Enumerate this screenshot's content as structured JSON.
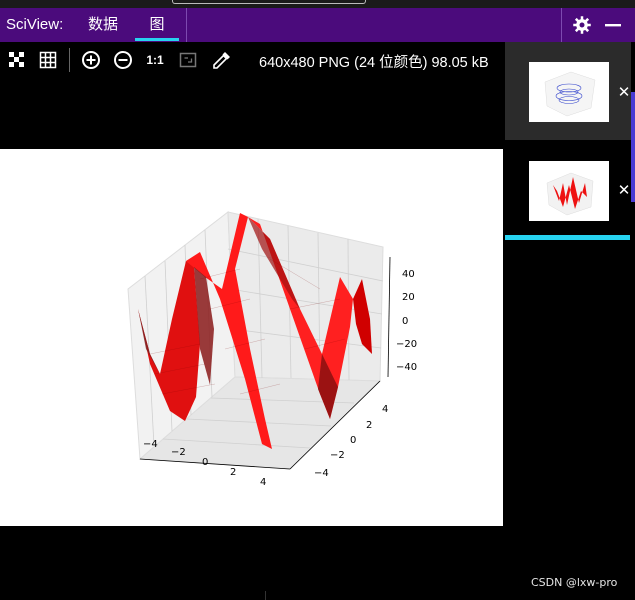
{
  "header": {
    "app_name": "SciView:",
    "tabs": [
      {
        "label": "数据",
        "active": false
      },
      {
        "label": "图",
        "active": true
      }
    ],
    "background_color": "#4b0b7c",
    "accent_color": "#27d3f0",
    "buttons": [
      {
        "name": "settings",
        "icon": "gear-icon"
      },
      {
        "name": "minimize",
        "icon": "minus-icon"
      }
    ]
  },
  "toolbar": {
    "buttons": [
      {
        "name": "actual-fit",
        "icon": "checkerboard-icon"
      },
      {
        "name": "grid",
        "icon": "grid-icon"
      },
      {
        "name": "zoom-in",
        "icon": "zoom-in-icon"
      },
      {
        "name": "zoom-out",
        "icon": "zoom-out-icon"
      },
      {
        "name": "actual-size",
        "label": "1:1"
      },
      {
        "name": "fit-to-window",
        "icon": "fit-window-icon"
      },
      {
        "name": "color-picker",
        "icon": "eyedropper-icon"
      }
    ],
    "image_info": "640x480 PNG (24 位颜色) 98.05 kB"
  },
  "plot": {
    "surface_color": "#ff0000",
    "z_ticks": [
      "40",
      "20",
      "0",
      "−20",
      "−40"
    ],
    "x_ticks": [
      "−4",
      "−2",
      "0",
      "2",
      "4"
    ],
    "y_ticks": [
      "4",
      "2",
      "0",
      "−2",
      "−4"
    ]
  },
  "thumbnails": [
    {
      "name": "contour-3d-plot",
      "selected": false
    },
    {
      "name": "surface-3d-plot",
      "selected": true
    }
  ],
  "thumbnail_close_label": "✕",
  "watermark": "CSDN @lxw-pro"
}
